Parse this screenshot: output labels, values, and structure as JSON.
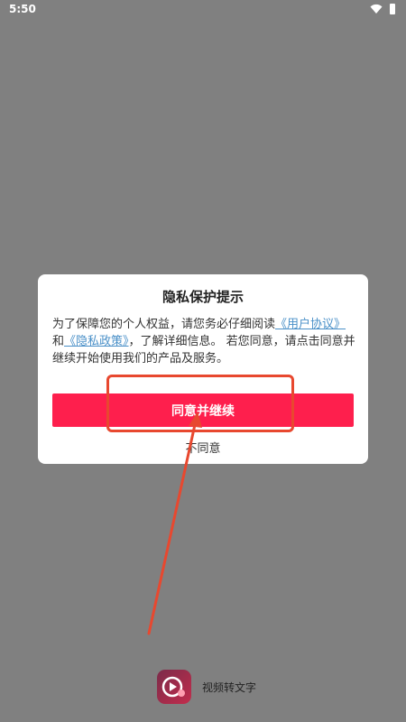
{
  "status_bar": {
    "time": "5:50"
  },
  "dialog": {
    "title": "隐私保护提示",
    "body_prefix": "为了保障您的个人权益，请您务必仔细阅读",
    "link_user_agreement": "《用户协议》",
    "body_and": "和",
    "link_privacy_policy": "《隐私政策》",
    "body_suffix": "，了解详细信息。 若您同意，请点击同意并继续开始使用我们的产品及服务。",
    "agree_label": "同意并继续",
    "disagree_label": "不同意"
  },
  "app": {
    "name": "视频转文字",
    "logo_icon": "video-play-icon"
  },
  "colors": {
    "accent": "#fe1f4d",
    "link": "#4a90c8",
    "annotation": "#e8482f"
  }
}
